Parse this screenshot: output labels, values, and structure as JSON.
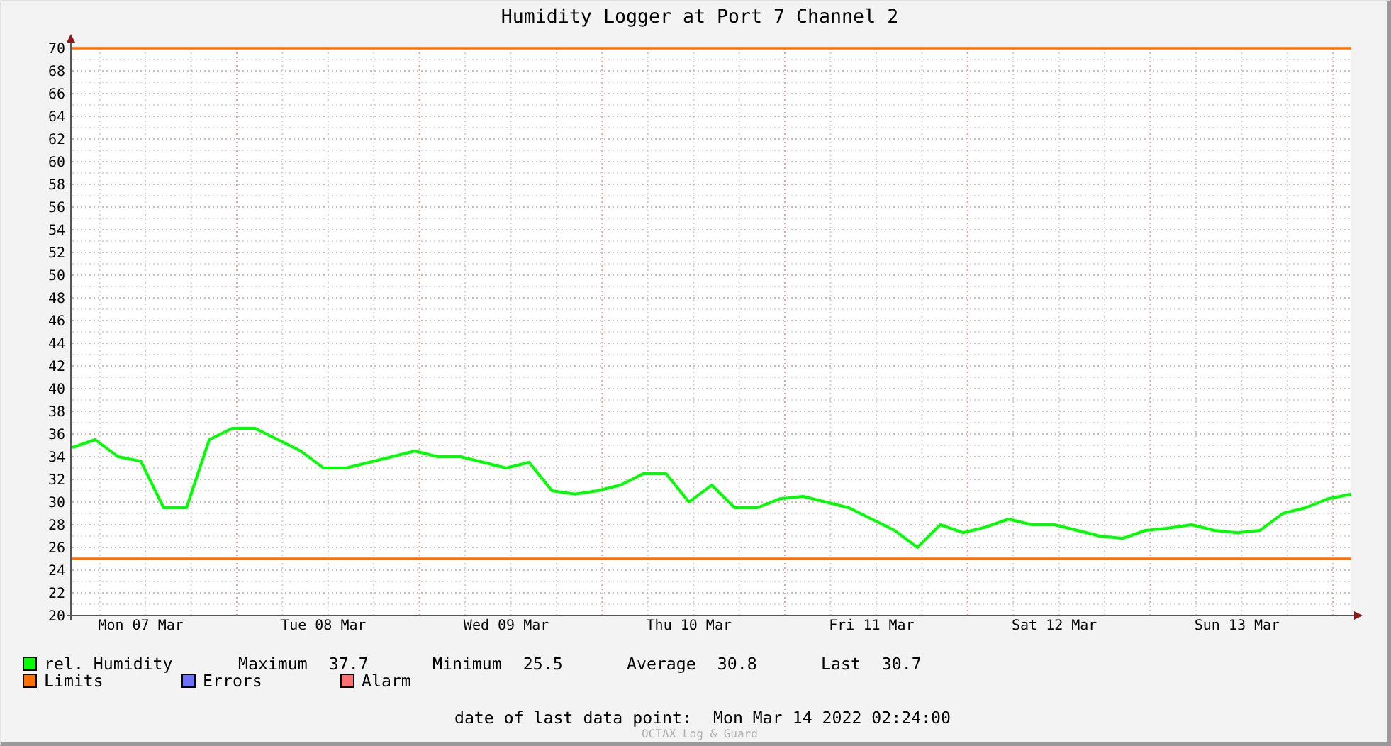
{
  "graph": {
    "chart_data": {
      "type": "line",
      "title": "Humidity Logger at Port 7 Channel 2",
      "ylim": [
        20,
        70
      ],
      "categories": [
        null,
        null,
        null,
        "Mon 07 Mar",
        null,
        null,
        null,
        null,
        null,
        null,
        null,
        "Tue 08 Mar",
        null,
        null,
        null,
        null,
        null,
        null,
        null,
        "Wed 09 Mar",
        null,
        null,
        null,
        null,
        null,
        null,
        null,
        "Thu 10 Mar",
        null,
        null,
        null,
        null,
        null,
        null,
        null,
        "Fri 11 Mar",
        null,
        null,
        null,
        null,
        null,
        null,
        null,
        "Sat 12 Mar",
        null,
        null,
        null,
        null,
        null,
        null,
        null,
        "Sun 13 Mar",
        null,
        null,
        null,
        null,
        null
      ],
      "yticks": [
        20,
        22,
        24,
        26,
        28,
        30,
        32,
        34,
        36,
        38,
        40,
        42,
        44,
        46,
        48,
        50,
        52,
        54,
        56,
        58,
        60,
        62,
        64,
        66,
        68,
        70
      ],
      "series": [
        {
          "name": "rel. Humidity",
          "color": "#00ff00",
          "values": [
            34.8,
            35.5,
            34.0,
            33.6,
            29.5,
            29.5,
            35.5,
            36.5,
            36.5,
            35.5,
            34.5,
            33.0,
            33.0,
            33.5,
            34.0,
            34.5,
            34.0,
            34.0,
            33.5,
            33.0,
            33.5,
            31.0,
            30.7,
            31.0,
            31.5,
            32.5,
            32.5,
            30.0,
            31.5,
            29.5,
            29.5,
            30.3,
            30.5,
            30.0,
            29.5,
            28.5,
            27.5,
            26.0,
            28.0,
            27.3,
            27.8,
            28.5,
            28.0,
            28.0,
            27.5,
            27.0,
            26.8,
            27.5,
            27.7,
            28.0,
            27.5,
            27.3,
            27.5,
            29.0,
            29.5,
            30.3,
            30.7
          ]
        },
        {
          "name": "Limits",
          "color": "#ff7000",
          "values": [
            25,
            25,
            25,
            25,
            25,
            25,
            25,
            25,
            25,
            25,
            25,
            25,
            25,
            25,
            25,
            25,
            25,
            25,
            25,
            25,
            25,
            25,
            25,
            25,
            25,
            25,
            25,
            25,
            25,
            25,
            25,
            25,
            25,
            25,
            25,
            25,
            25,
            25,
            25,
            25,
            25,
            25,
            25,
            25,
            25,
            25,
            25,
            25,
            25,
            25,
            25,
            25,
            25,
            25,
            25,
            25,
            25
          ]
        },
        {
          "color": "#ff7000",
          "values": [
            70,
            70,
            70,
            70,
            70,
            70,
            70,
            70,
            70,
            70,
            70,
            70,
            70,
            70,
            70,
            70,
            70,
            70,
            70,
            70,
            70,
            70,
            70,
            70,
            70,
            70,
            70,
            70,
            70,
            70,
            70,
            70,
            70,
            70,
            70,
            70,
            70,
            70,
            70,
            70,
            70,
            70,
            70,
            70,
            70,
            70,
            70,
            70,
            70,
            70,
            70,
            70,
            70,
            70,
            70,
            70,
            70
          ]
        }
      ],
      "grid": true
    }
  },
  "legend": [
    {
      "label": "Errors",
      "color": "#7070ff"
    },
    {
      "label": "Alarm",
      "color": "#ff7070"
    }
  ],
  "stats": [
    {
      "label": "Maximum",
      "value": "37.7"
    },
    {
      "label": "Minimum",
      "value": "25.5"
    },
    {
      "label": "Average",
      "value": "30.8"
    },
    {
      "label": "Last",
      "value": "30.7"
    }
  ],
  "last_data_point": {
    "label": "date of last data point:",
    "value": "Mon Mar 14 2022 02:24:00"
  },
  "watermark": "OCTAX Log & Guard"
}
